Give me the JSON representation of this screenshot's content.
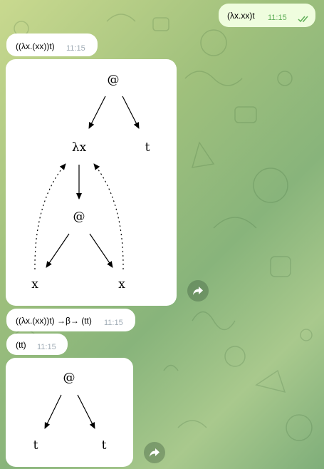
{
  "chat": {
    "outgoing": {
      "text": "(λx.xx)t",
      "time": "11:15"
    },
    "msg1": {
      "text": "((λx.(xx))t)",
      "time": "11:15"
    },
    "tree1": {
      "root": "@",
      "lambda": "λx",
      "arg": "t",
      "inner": "@",
      "left": "x",
      "right": "x"
    },
    "msg2": {
      "text": "((λx.(xx))t) →β→ (tt)",
      "time": "11:15"
    },
    "msg3": {
      "text": "(tt)",
      "time": "11:15"
    },
    "tree2": {
      "root": "@",
      "left": "t",
      "right": "t"
    }
  },
  "icons": {
    "read_status": "double-check-icon",
    "share": "share-arrow-icon"
  },
  "colors": {
    "outgoing_bubble": "#effdde",
    "incoming_bubble": "#ffffff",
    "timestamp": "#a0acb6",
    "outgoing_timestamp": "#5fae57",
    "read_check": "#5fae57"
  }
}
